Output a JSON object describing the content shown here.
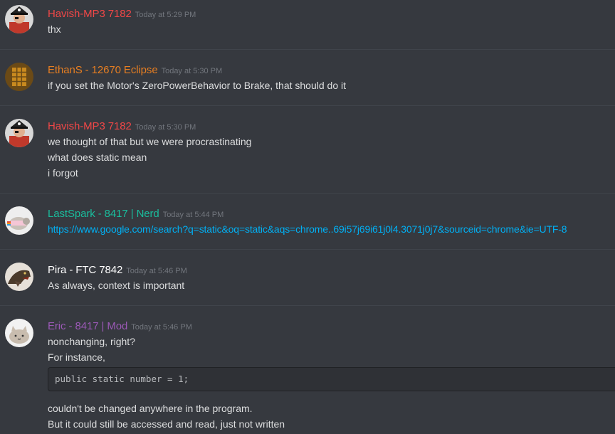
{
  "messages": [
    {
      "author": "Havish-MP3 7182",
      "author_color": "#f04747",
      "timestamp": "Today at 5:29 PM",
      "avatar": "pirate-avatar-icon",
      "lines": [
        "thx"
      ]
    },
    {
      "author": "EthanS - 12670 Eclipse",
      "author_color": "#e67e22",
      "timestamp": "Today at 5:30 PM",
      "avatar": "chocolate-bar-avatar-icon",
      "lines": [
        "if you set the Motor's ZeroPowerBehavior to Brake, that should do it"
      ]
    },
    {
      "author": "Havish-MP3 7182",
      "author_color": "#f04747",
      "timestamp": "Today at 5:30 PM",
      "avatar": "pirate-avatar-icon",
      "lines": [
        "we thought of that but we were procrastinating",
        "what does static mean",
        "i forgot"
      ]
    },
    {
      "author": "LastSpark - 8417 | Nerd",
      "author_color": "#1abc9c",
      "timestamp": "Today at 5:44 PM",
      "avatar": "nyan-cat-avatar-icon",
      "link": "https://www.google.com/search?q=static&oq=static&aqs=chrome..69i57j69i61j0l4.3071j0j7&sourceid=chrome&ie=UTF-8"
    },
    {
      "author": "Pira - FTC 7842",
      "author_color": "#ffffff",
      "timestamp": "Today at 5:46 PM",
      "avatar": "dinosaur-avatar-icon",
      "lines": [
        "As always, context is important"
      ]
    },
    {
      "author": "Eric - 8417 | Mod",
      "author_color": "#9b59b6",
      "timestamp": "Today at 5:46 PM",
      "avatar": "cat-avatar-icon",
      "lines": [
        "nonchanging, right?",
        "For instance,"
      ],
      "code": "public static number = 1;",
      "lines_after": [
        "couldn't be changed anywhere in the program.",
        "But it could still be accessed and read, just not written"
      ]
    }
  ],
  "colors": {
    "background": "#36393f",
    "text": "#dcddde",
    "timestamp": "#72767d",
    "link": "#00b0f4",
    "divider": "#40444b"
  }
}
